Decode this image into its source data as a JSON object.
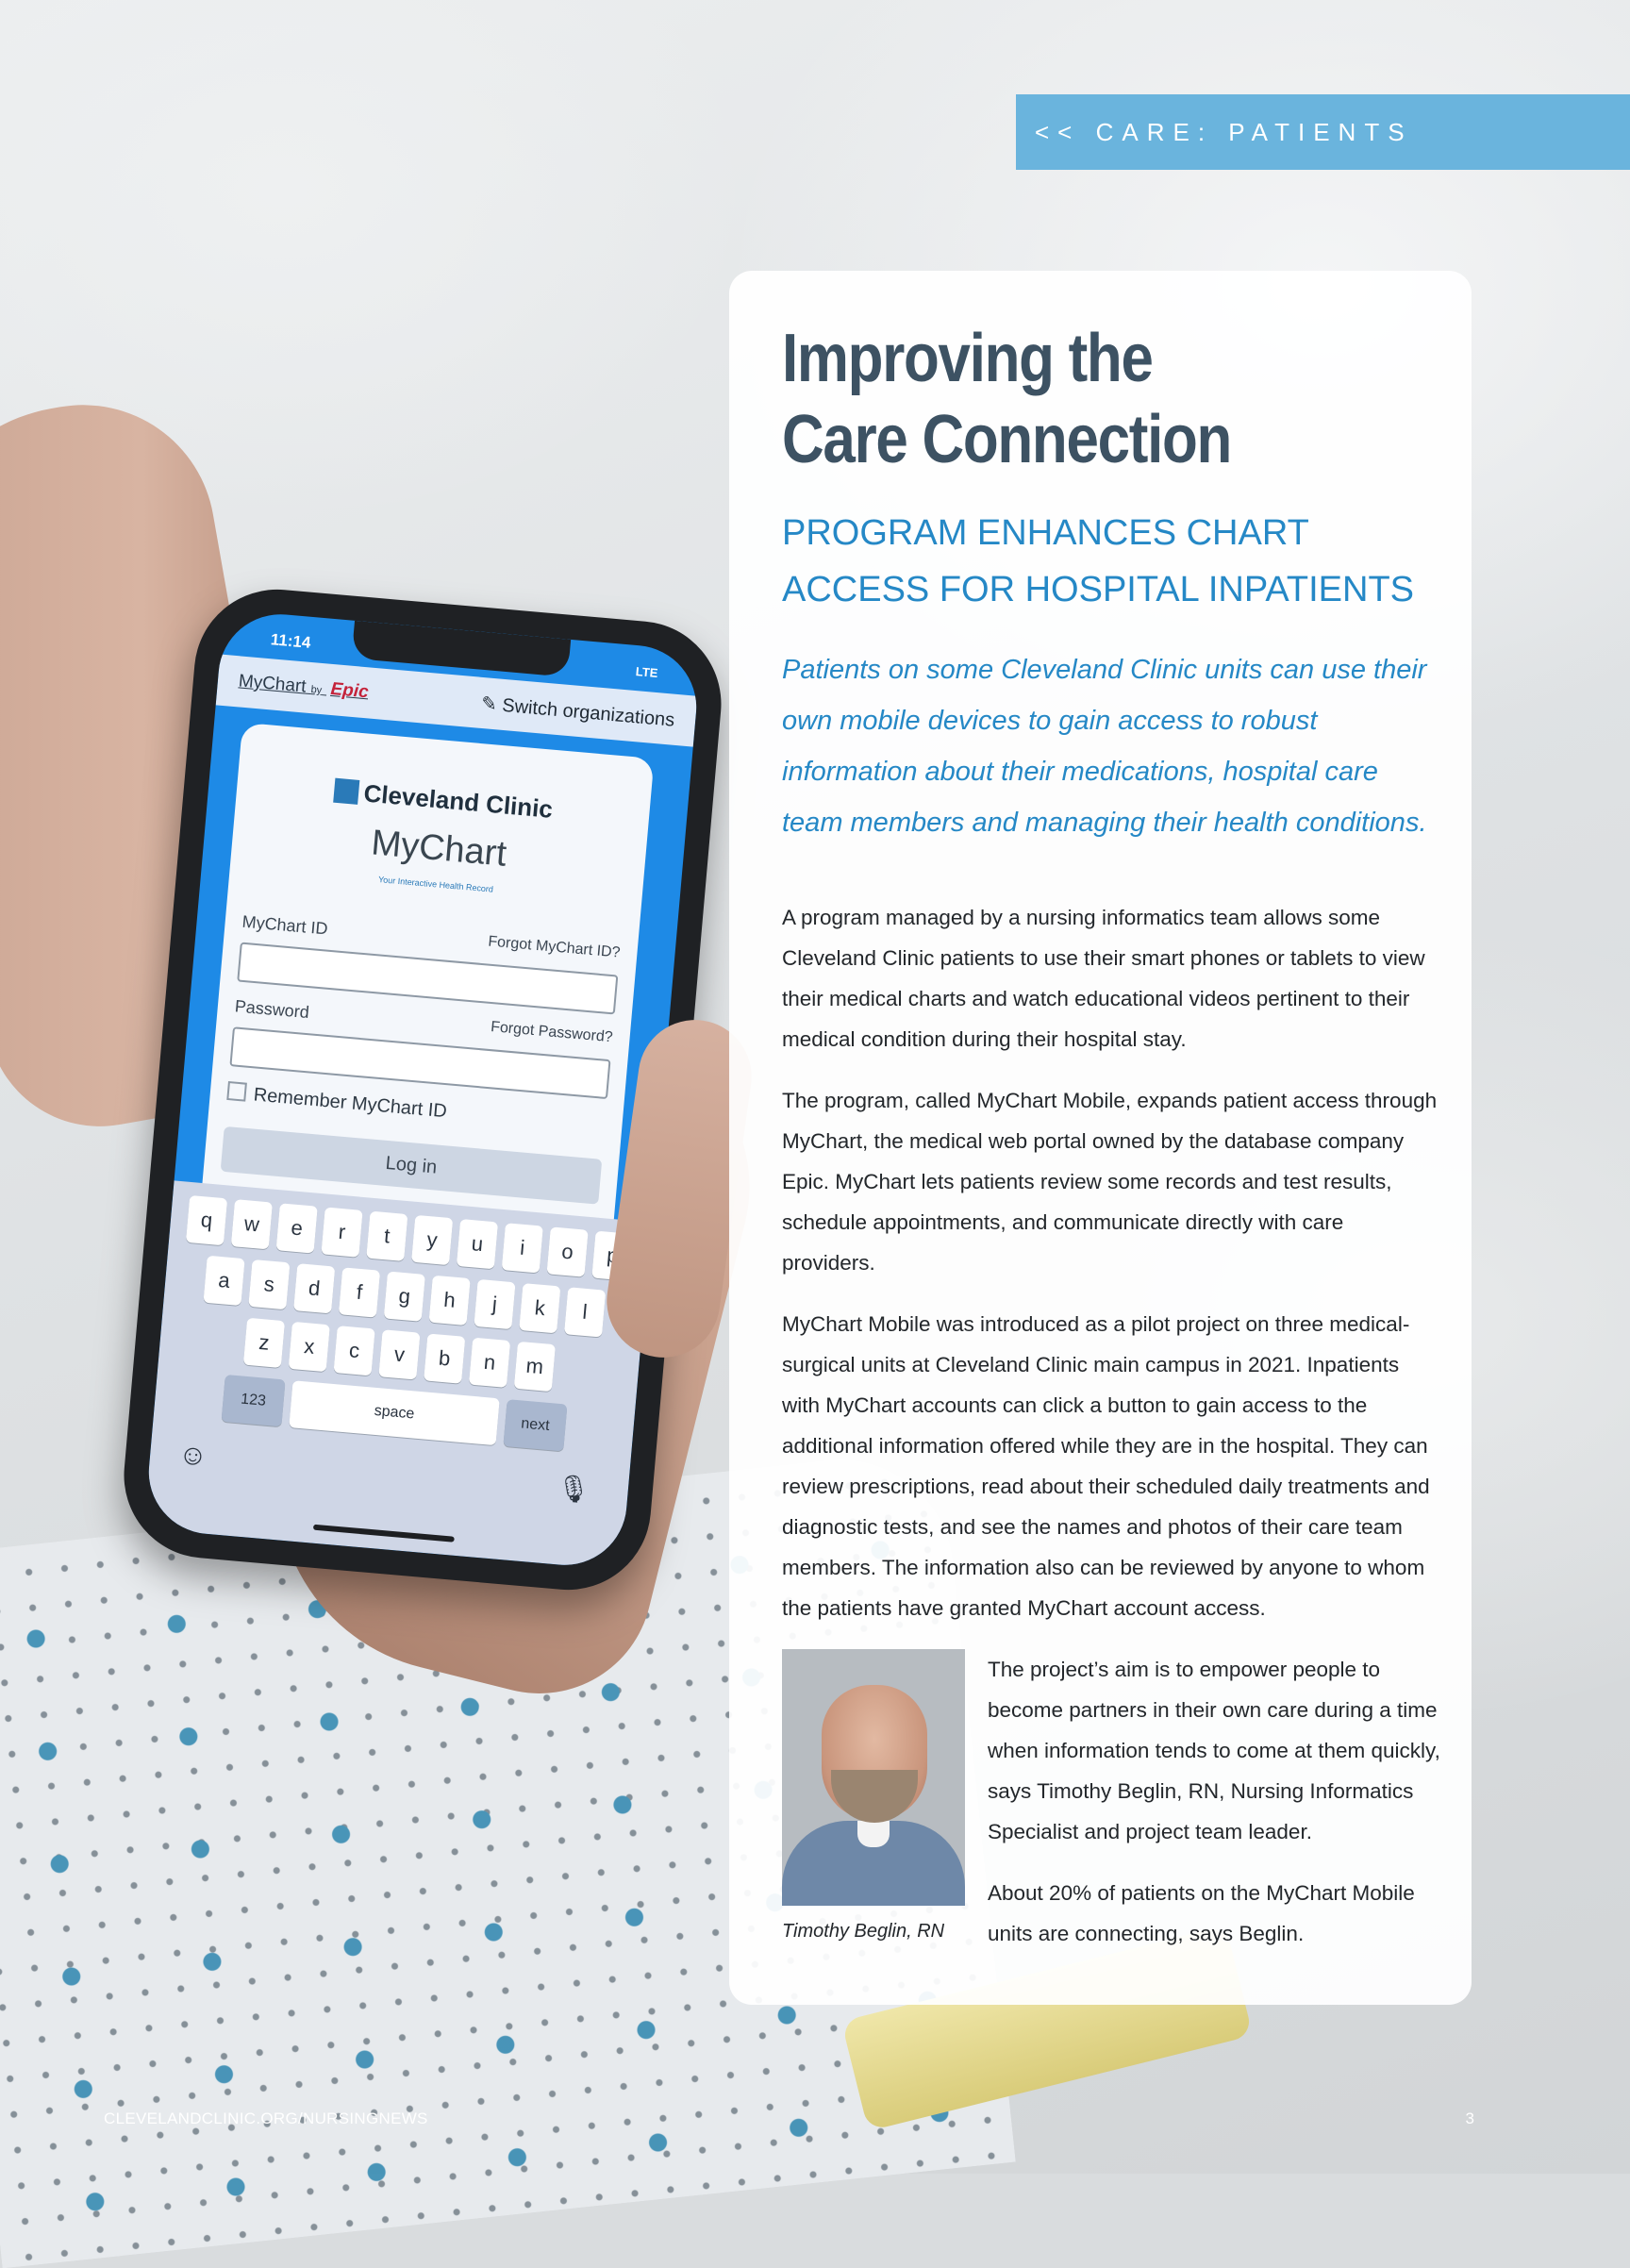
{
  "section_tag": "<< CARE: PATIENTS",
  "article": {
    "title_line1": "Improving the",
    "title_line2": "Care Connection",
    "subtitle_line1": "PROGRAM ENHANCES CHART",
    "subtitle_line2": "ACCESS FOR HOSPITAL INPATIENTS",
    "deck": "Patients on some Cleveland Clinic units can use their own mobile devices to gain access to robust information about their medications, hospital care team members and managing their health conditions.",
    "paragraphs": [
      "A program managed by a nursing informatics team allows some Cleveland Clinic patients to use their smart phones or tablets to view their medical charts and watch educational videos pertinent to their medical condition during their hospital stay.",
      "The program, called MyChart Mobile, expands patient access through MyChart, the medical web portal owned by the database company Epic. MyChart lets patients review some records and test results, schedule appointments, and communicate directly with care providers.",
      "MyChart Mobile was introduced as a pilot project on three medical-surgical units at Cleveland Clinic main campus in 2021. Inpatients with MyChart accounts can click a button to gain access to the additional information offered while they are in the hospital. They can review prescriptions, read about their scheduled daily treatments and diagnostic tests, and see the names and photos of their care team members. The information also can be reviewed by anyone to whom the patients have granted MyChart account access.",
      "The project’s aim is to empower people to become partners in their own care during a time when information tends to come at them quickly, says Timothy Beglin, RN, Nursing Informatics Specialist and project team leader.",
      "About 20% of patients on the MyChart Mobile units are connecting, says Beglin."
    ],
    "photo_caption": "Timothy Beglin, RN"
  },
  "phone_screen": {
    "time": "11:14",
    "network": "LTE",
    "brand": "MyChart",
    "brand_by": "by",
    "brand_epic": "Epic",
    "switch_org": "Switch organizations",
    "org_name": "Cleveland Clinic",
    "app_name": "MyChart",
    "app_tagline": "Your Interactive Health Record",
    "id_label": "MyChart ID",
    "forgot_id": "Forgot MyChart ID?",
    "password_label": "Password",
    "forgot_password": "Forgot Password?",
    "remember_label": "Remember MyChart ID",
    "login_label": "Log in",
    "keys_row1": [
      "q",
      "w",
      "e",
      "r",
      "t",
      "y",
      "u",
      "i",
      "o",
      "p"
    ],
    "keys_row2": [
      "a",
      "s",
      "d",
      "f",
      "g",
      "h",
      "j",
      "k",
      "l"
    ],
    "keys_row3": [
      "z",
      "x",
      "c",
      "v",
      "b",
      "n",
      "m"
    ],
    "key_123": "123",
    "key_space": "space",
    "key_next": "next"
  },
  "footer": {
    "url": "CLEVELANDCLINIC.ORG/NURSINGNEWS",
    "page_number": "3"
  },
  "colors": {
    "tag_bg": "#6ab4dd",
    "title": "#3d5263",
    "accent_blue": "#2588c6"
  }
}
